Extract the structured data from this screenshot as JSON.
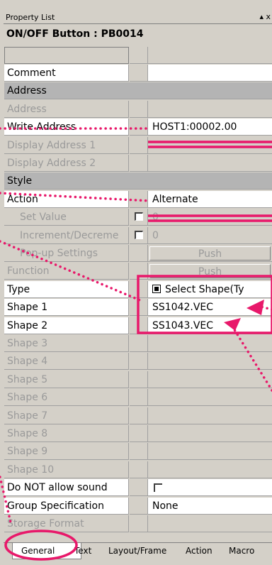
{
  "window": {
    "title": "Property List",
    "controls": "▴ x",
    "object_header": "ON/OFF Button : PB0014"
  },
  "rows": [
    {
      "label": "Comment",
      "value": "",
      "style": "n"
    },
    {
      "label": "Address",
      "value": "",
      "style": "cat"
    },
    {
      "label": "Address",
      "value": "",
      "style": "d"
    },
    {
      "label": "Write Address",
      "value": "HOST1:00002.00",
      "style": "n"
    },
    {
      "label": "Display Address 1",
      "value": "",
      "style": "d"
    },
    {
      "label": "Display Address 2",
      "value": "",
      "style": "d"
    },
    {
      "label": "Style",
      "value": "",
      "style": "cat"
    },
    {
      "label": "Action",
      "value": "Alternate",
      "style": "n"
    },
    {
      "label": "Set Value",
      "value": "0",
      "style": "d",
      "checkbox": true
    },
    {
      "label": "Increment/Decreme",
      "value": "0",
      "style": "d",
      "checkbox": true
    },
    {
      "label": "Pop-up Settings",
      "value": "Push",
      "style": "d",
      "button": true
    },
    {
      "label": "Function",
      "value": "Push",
      "style": "d",
      "button": true
    },
    {
      "label": "Type",
      "value": "Select Shape(Ty",
      "style": "n",
      "icon": true
    },
    {
      "label": "Shape 1",
      "value": "SS1042.VEC",
      "style": "n"
    },
    {
      "label": "Shape 2",
      "value": "SS1043.VEC",
      "style": "n"
    },
    {
      "label": "Shape 3",
      "value": "",
      "style": "d"
    },
    {
      "label": "Shape 4",
      "value": "",
      "style": "d"
    },
    {
      "label": "Shape 5",
      "value": "",
      "style": "d"
    },
    {
      "label": "Shape 6",
      "value": "",
      "style": "d"
    },
    {
      "label": "Shape 7",
      "value": "",
      "style": "d"
    },
    {
      "label": "Shape 8",
      "value": "",
      "style": "d"
    },
    {
      "label": "Shape 9",
      "value": "",
      "style": "d"
    },
    {
      "label": "Shape 10",
      "value": "",
      "style": "d"
    },
    {
      "label": "Do NOT allow sound",
      "value": "",
      "style": "n",
      "vcheckbox": true
    },
    {
      "label": "Group Specification",
      "value": "None",
      "style": "n"
    },
    {
      "label": "Storage Format",
      "value": "",
      "style": "d"
    }
  ],
  "tabs": [
    "General",
    "Text",
    "Layout/Frame",
    "Action",
    "Macro"
  ],
  "colors": {
    "annotation": "#e8186a",
    "panel": "#d4d0c8",
    "category": "#b4b4b4"
  }
}
